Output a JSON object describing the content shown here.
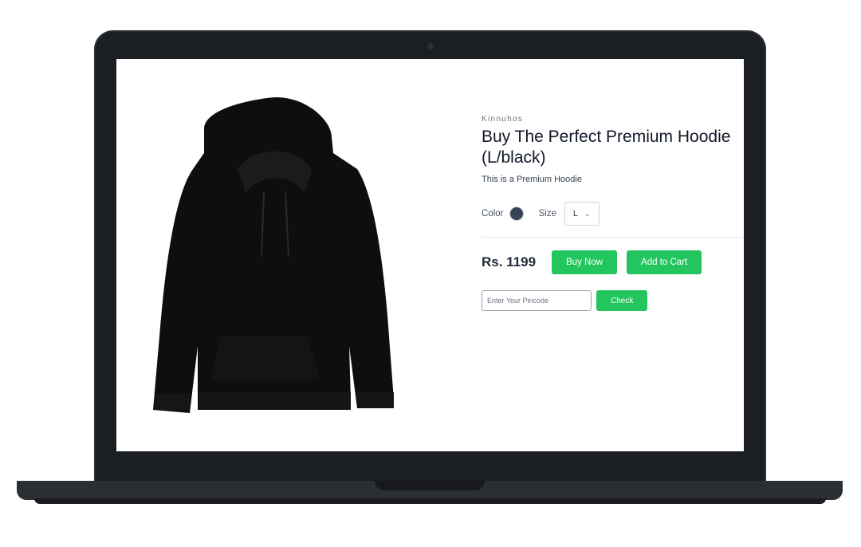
{
  "product": {
    "brand": "Kinnuhos",
    "title": "Buy The Perfect Premium Hoodie",
    "variant": "(L/black)",
    "description": "This is a Premium Hoodie",
    "image_icon": "hoodie-image"
  },
  "options": {
    "color_label": "Color",
    "color_value": "#3a4354",
    "size_label": "Size",
    "size_selected": "L",
    "size_chevron": "⌄"
  },
  "purchase": {
    "price": "Rs. 1199",
    "buy_now_label": "Buy Now",
    "add_to_cart_label": "Add to Cart",
    "accent_color": "#22c55e"
  },
  "pincode": {
    "placeholder": "Enter Your Pincode",
    "check_label": "Check"
  }
}
